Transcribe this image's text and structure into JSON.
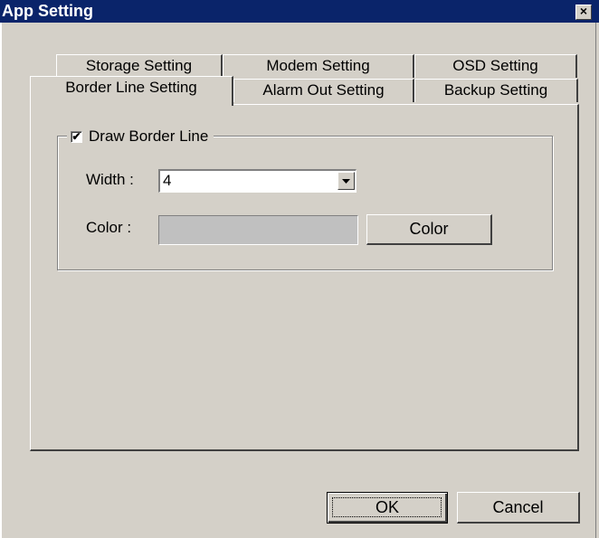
{
  "window": {
    "title": "App Setting",
    "close_glyph": "×"
  },
  "tabs": {
    "back_row": [
      "Storage Setting",
      "Modem Setting",
      "OSD Setting"
    ],
    "front_row": [
      "Border Line Setting",
      "Alarm Out Setting",
      "Backup Setting"
    ],
    "active": "Border Line Setting"
  },
  "group": {
    "checkbox_label": "Draw Border Line",
    "checkbox_checked": true,
    "checkbox_glyph": "✔"
  },
  "width_field": {
    "label": "Width :",
    "value": "4"
  },
  "color_field": {
    "label": "Color :",
    "swatch_color": "#c0c0c0",
    "button_label": "Color"
  },
  "footer": {
    "ok_label": "OK",
    "cancel_label": "Cancel"
  },
  "icons": {
    "close": "close-icon",
    "dropdown": "chevron-down-icon",
    "checkbox": "checkmark-icon"
  },
  "colors": {
    "titlebar": "#0a246a",
    "face": "#d4d0c8"
  }
}
